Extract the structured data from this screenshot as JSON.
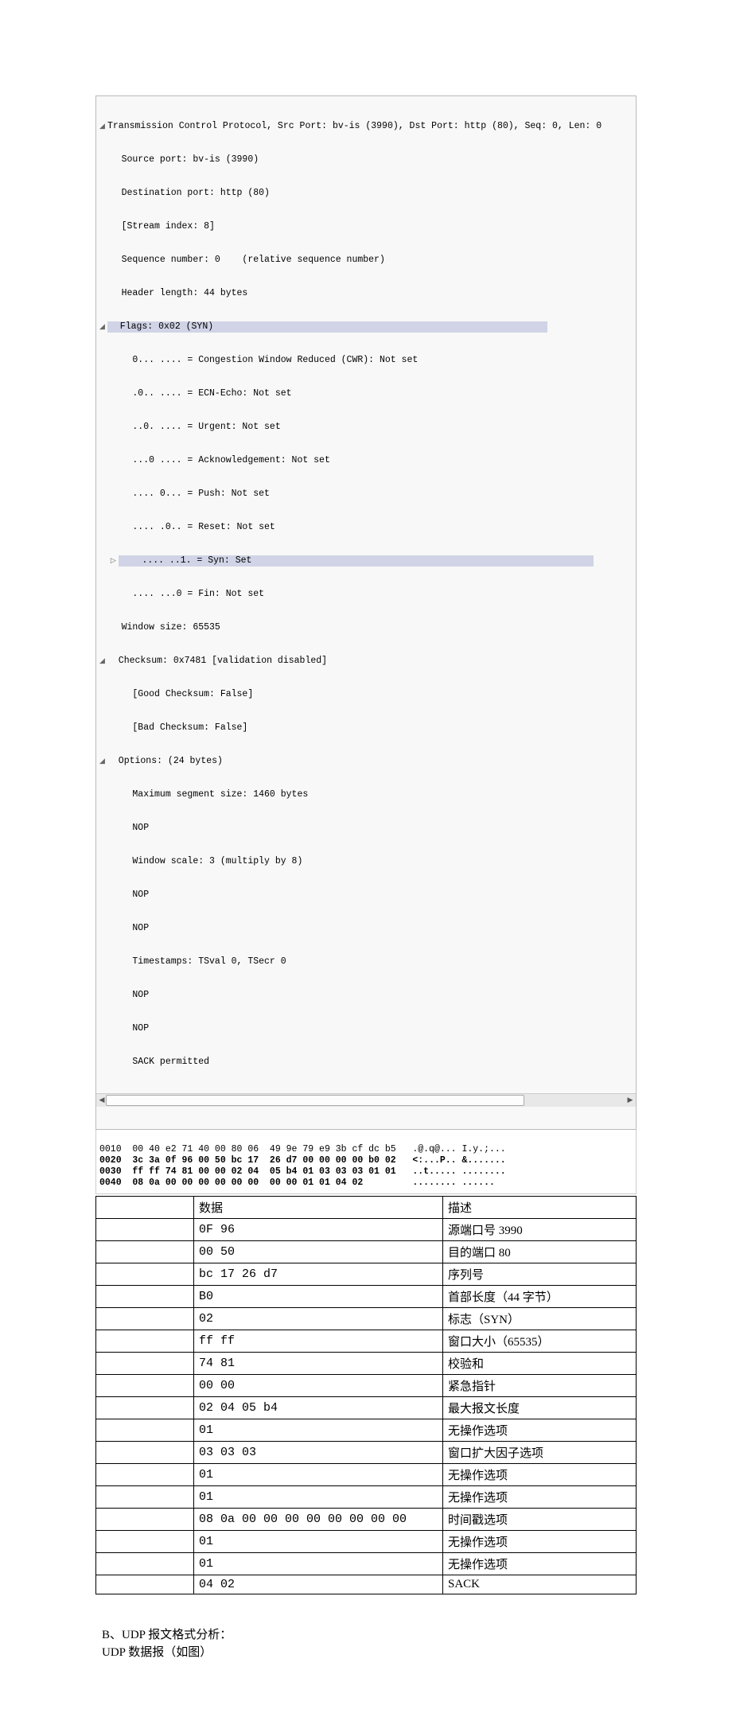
{
  "packet_header": "Transmission Control Protocol, Src Port: bv-is (3990), Dst Port: http (80), Seq: 0, Len: 0",
  "lines": {
    "l1": "    Source port: bv-is (3990)",
    "l2": "    Destination port: http (80)",
    "l3": "    [Stream index: 8]",
    "l4": "    Sequence number: 0    (relative sequence number)",
    "l5": "    Header length: 44 bytes",
    "l6": "  Flags: 0x02 (SYN)",
    "l7": "      0... .... = Congestion Window Reduced (CWR): Not set",
    "l8": "      .0.. .... = ECN-Echo: Not set",
    "l9": "      ..0. .... = Urgent: Not set",
    "l10": "      ...0 .... = Acknowledgement: Not set",
    "l11": "      .... 0... = Push: Not set",
    "l12": "      .... .0.. = Reset: Not set",
    "l13": "    .... ..1. = Syn: Set",
    "l14": "      .... ...0 = Fin: Not set",
    "l15": "    Window size: 65535",
    "l16": "  Checksum: 0x7481 [validation disabled]",
    "l17": "      [Good Checksum: False]",
    "l18": "      [Bad Checksum: False]",
    "l19": "  Options: (24 bytes)",
    "l20": "      Maximum segment size: 1460 bytes",
    "l21": "      NOP",
    "l22": "      Window scale: 3 (multiply by 8)",
    "l23": "      NOP",
    "l24": "      NOP",
    "l25": "      Timestamps: TSval 0, TSecr 0",
    "l26": "      NOP",
    "l27": "      NOP",
    "l28": "      SACK permitted"
  },
  "hex": {
    "r1": "0010  00 40 e2 71 40 00 80 06  49 9e 79 e9 3b cf dc b5   .@.q@... I.y.;...",
    "r2": "0020  3c 3a 0f 96 00 50 bc 17  26 d7 00 00 00 00 b0 02   <:...P.. &.......",
    "r3": "0030  ff ff 74 81 00 00 02 04  05 b4 01 03 03 03 01 01   ..t..... ........",
    "r4": "0040  08 0a 00 00 00 00 00 00  00 00 01 01 04 02         ........ ......"
  },
  "table": {
    "header": {
      "c1": "",
      "c2": "数据",
      "c3": "描述"
    },
    "rows": [
      {
        "c1": "",
        "c2": "0F 96",
        "c3": "源端口号 3990"
      },
      {
        "c1": "",
        "c2": "00 50",
        "c3": "目的端口 80"
      },
      {
        "c1": "",
        "c2": "bc 17 26 d7",
        "c3": "序列号"
      },
      {
        "c1": "",
        "c2": "B0",
        "c3": "首部长度（44 字节）"
      },
      {
        "c1": "",
        "c2": "02",
        "c3": "标志（SYN）"
      },
      {
        "c1": "",
        "c2": "ff ff",
        "c3": "窗口大小（65535）"
      },
      {
        "c1": "",
        "c2": "74 81",
        "c3": "校验和"
      },
      {
        "c1": "",
        "c2": "00 00",
        "c3": "紧急指针"
      },
      {
        "c1": "",
        "c2": "02 04 05 b4",
        "c3": "最大报文长度"
      },
      {
        "c1": "",
        "c2": "01",
        "c3": "无操作选项"
      },
      {
        "c1": "",
        "c2": "03 03 03",
        "c3": "窗口扩大因子选项"
      },
      {
        "c1": "",
        "c2": "01",
        "c3": "无操作选项"
      },
      {
        "c1": "",
        "c2": "01",
        "c3": "无操作选项"
      },
      {
        "c1": "",
        "c2": "08 0a 00 00 00 00 00 00 00 00",
        "c3": "时间戳选项"
      },
      {
        "c1": "",
        "c2": "01",
        "c3": "无操作选项"
      },
      {
        "c1": "",
        "c2": "01",
        "c3": "无操作选项"
      },
      {
        "c1": "",
        "c2": "04 02",
        "c3": "SACK"
      }
    ]
  },
  "udp": {
    "l1": "B、UDP 报文格式分析：",
    "l2": "  UDP 数据报（如图）"
  }
}
